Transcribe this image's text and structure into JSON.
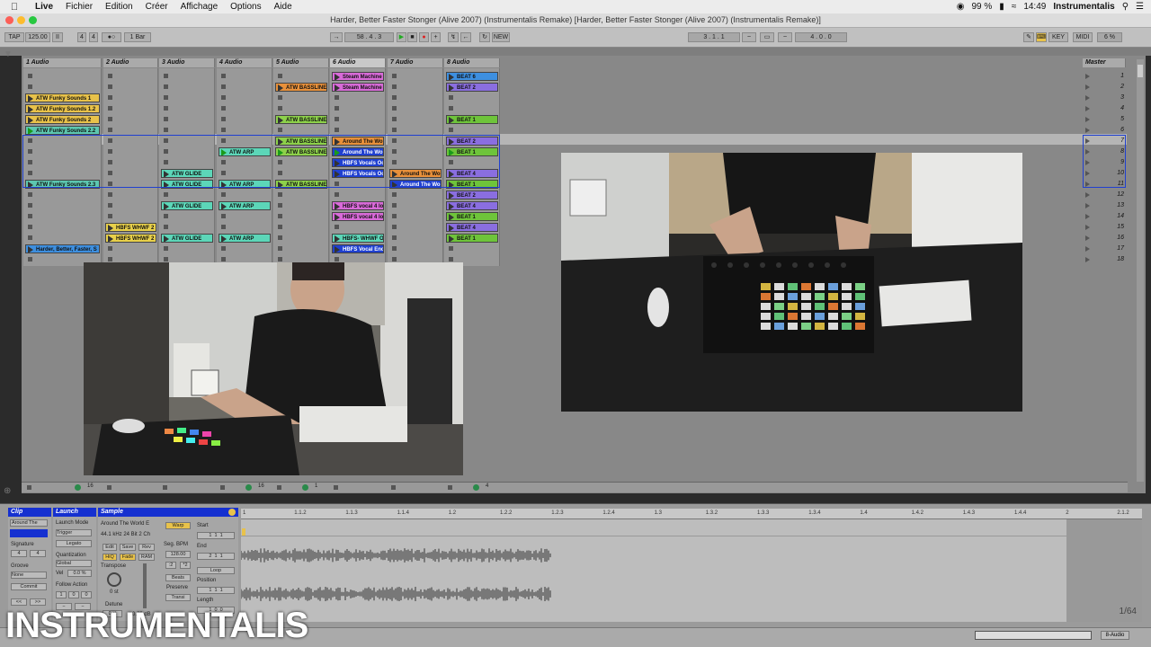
{
  "menubar": {
    "app": "Live",
    "items": [
      "Fichier",
      "Edition",
      "Créer",
      "Affichage",
      "Options",
      "Aide"
    ],
    "battery": "99 %",
    "time": "14:49",
    "user": "Instrumentalis"
  },
  "window_title": "Harder, Better Faster Stonger (Alive 2007) (Instrumentalis Remake)  [Harder, Better Faster Stonger (Alive 2007) (Instrumentalis Remake)]",
  "control_bar": {
    "tap": "TAP",
    "tempo": "125.00",
    "time_sig_num": "4",
    "time_sig_den": "4",
    "quant": "1 Bar",
    "position": "58 .  4 .  3",
    "new_label": "NEW",
    "loop_start": "3 .  1 .  1",
    "loop_len": "4 .  0 .  0",
    "key": "KEY",
    "midi": "MIDI",
    "cpu": "6 %"
  },
  "tracks": [
    {
      "name": "1 Audio"
    },
    {
      "name": "2 Audio"
    },
    {
      "name": "3 Audio"
    },
    {
      "name": "4 Audio"
    },
    {
      "name": "5 Audio"
    },
    {
      "name": "6 Audio"
    },
    {
      "name": "7 Audio"
    },
    {
      "name": "8 Audio"
    }
  ],
  "master": {
    "name": "Master",
    "scenes": [
      "1",
      "2",
      "3",
      "4",
      "5",
      "6",
      "7",
      "8",
      "9",
      "10",
      "11",
      "12",
      "13",
      "14",
      "15",
      "16",
      "17",
      "18"
    ]
  },
  "clips": [
    {
      "t": 0,
      "r": 2,
      "label": "ATW Funky Sounds 1",
      "color": "#e8c24a"
    },
    {
      "t": 0,
      "r": 3,
      "label": "ATW Funky Sounds 1.2",
      "color": "#e8c24a"
    },
    {
      "t": 0,
      "r": 4,
      "label": "ATW Funky Sounds 2",
      "color": "#e8c24a"
    },
    {
      "t": 0,
      "r": 5,
      "label": "ATW Funky Sounds 2.2",
      "color": "#5cc7b0",
      "playing": true
    },
    {
      "t": 0,
      "r": 10,
      "label": "ATW Funky Sounds 2.3",
      "color": "#5cc7b0"
    },
    {
      "t": 0,
      "r": 16,
      "label": "Harder, Better, Faster, S",
      "color": "#3d8fe0"
    },
    {
      "t": 1,
      "r": 14,
      "label": "HBFS WHWF 2",
      "color": "#e8d04a"
    },
    {
      "t": 1,
      "r": 15,
      "label": "HBFS WHWF 2",
      "color": "#e8d04a"
    },
    {
      "t": 2,
      "r": 9,
      "label": "ATW GLIDE",
      "color": "#5cd6b8"
    },
    {
      "t": 2,
      "r": 10,
      "label": "ATW GLIDE",
      "color": "#5cd6b8"
    },
    {
      "t": 2,
      "r": 12,
      "label": "ATW GLIDE",
      "color": "#5cd6b8"
    },
    {
      "t": 2,
      "r": 15,
      "label": "ATW GLIDE",
      "color": "#5cd6b8"
    },
    {
      "t": 3,
      "r": 7,
      "label": "ATW ARP",
      "color": "#5cd6b8",
      "playing": true
    },
    {
      "t": 3,
      "r": 10,
      "label": "ATW ARP",
      "color": "#5cd6b8"
    },
    {
      "t": 3,
      "r": 12,
      "label": "ATW ARP",
      "color": "#5cd6b8"
    },
    {
      "t": 3,
      "r": 15,
      "label": "ATW ARP",
      "color": "#5cd6b8"
    },
    {
      "t": 4,
      "r": 1,
      "label": "ATW BASSLINE",
      "color": "#e8903a"
    },
    {
      "t": 4,
      "r": 4,
      "label": "ATW BASSLINE",
      "color": "#8dd14a"
    },
    {
      "t": 4,
      "r": 6,
      "label": "ATW BASSLINE",
      "color": "#8dd14a"
    },
    {
      "t": 4,
      "r": 7,
      "label": "ATW BASSLINE",
      "color": "#8dd14a",
      "playing": true
    },
    {
      "t": 4,
      "r": 10,
      "label": "ATW BASSLINE",
      "color": "#8dd14a"
    },
    {
      "t": 5,
      "r": 0,
      "label": "Steam Machine",
      "color": "#d86ad8"
    },
    {
      "t": 5,
      "r": 1,
      "label": "Steam Machine",
      "color": "#d86ad8"
    },
    {
      "t": 5,
      "r": 6,
      "label": "Around The Wo",
      "color": "#e8903a"
    },
    {
      "t": 5,
      "r": 7,
      "label": "Around The Wo",
      "color": "#2040d0",
      "playing": true,
      "light": true
    },
    {
      "t": 5,
      "r": 8,
      "label": "HBFS Vocals Oc",
      "color": "#2040d0",
      "light": true
    },
    {
      "t": 5,
      "r": 9,
      "label": "HBFS Vocals Oc",
      "color": "#2040d0",
      "light": true
    },
    {
      "t": 5,
      "r": 12,
      "label": "HBFS vocal 4 lo",
      "color": "#d86ad8"
    },
    {
      "t": 5,
      "r": 13,
      "label": "HBFS vocal 4 lo",
      "color": "#d86ad8"
    },
    {
      "t": 5,
      "r": 15,
      "label": "HBFS- WHWF O",
      "color": "#5cd6b8"
    },
    {
      "t": 5,
      "r": 16,
      "label": "HBFS Vocal End",
      "color": "#2040d0",
      "light": true
    },
    {
      "t": 6,
      "r": 9,
      "label": "Around The Wo",
      "color": "#e8903a"
    },
    {
      "t": 6,
      "r": 10,
      "label": "Around The Wo",
      "color": "#2040d0",
      "light": true
    },
    {
      "t": 7,
      "r": 0,
      "label": "BEAT 6",
      "color": "#3d8fe0"
    },
    {
      "t": 7,
      "r": 1,
      "label": "BEAT 2",
      "color": "#8a6ee0"
    },
    {
      "t": 7,
      "r": 4,
      "label": "BEAT 1",
      "color": "#6ec43a"
    },
    {
      "t": 7,
      "r": 6,
      "label": "BEAT 2",
      "color": "#8a6ee0"
    },
    {
      "t": 7,
      "r": 7,
      "label": "BEAT 1",
      "color": "#6ec43a",
      "playing": true
    },
    {
      "t": 7,
      "r": 9,
      "label": "BEAT 4",
      "color": "#8a6ee0"
    },
    {
      "t": 7,
      "r": 10,
      "label": "BEAT 1",
      "color": "#6ec43a"
    },
    {
      "t": 7,
      "r": 11,
      "label": "BEAT 2",
      "color": "#8a6ee0"
    },
    {
      "t": 7,
      "r": 12,
      "label": "BEAT 4",
      "color": "#8a6ee0"
    },
    {
      "t": 7,
      "r": 13,
      "label": "BEAT 1",
      "color": "#6ec43a"
    },
    {
      "t": 7,
      "r": 14,
      "label": "BEAT 4",
      "color": "#8a6ee0"
    },
    {
      "t": 7,
      "r": 15,
      "label": "BEAT 1",
      "color": "#6ec43a"
    }
  ],
  "track_footer": [
    {
      "t": 0,
      "value": "16"
    },
    {
      "t": 3,
      "value": "16"
    },
    {
      "t": 4,
      "value": "1"
    },
    {
      "t": 7,
      "value": "4"
    }
  ],
  "detail": {
    "clip_panel": {
      "title": "Clip",
      "name": "Around The",
      "signature": "Signature",
      "sig_num": "4",
      "sig_den": "4",
      "groove": "Groove",
      "groove_val": "None",
      "commit": "Commit"
    },
    "launch_panel": {
      "title": "Launch",
      "mode_label": "Launch Mode",
      "mode": "Trigger",
      "legato": "Legato",
      "quant_label": "Quantization",
      "quant": "Global",
      "vel_label": "Vel",
      "vel": "0.0 %",
      "follow": "Follow Action"
    },
    "sample_panel": {
      "title": "Sample",
      "file": "Around The World E",
      "info": "44.1 kHz 24 Bit 2 Ch",
      "warp": "Warp",
      "start": "Start",
      "end": "End",
      "edit": "Edit",
      "save": "Save",
      "rev": "Rev",
      "hiq": "HiQ",
      "fade": "Fade",
      "ram": "RAM",
      "transpose": "Transpose",
      "st": "0 st",
      "detune": "Detune",
      "ct": "0 ct",
      "db": "0.00 dB",
      "seg_bpm": "Seg. BPM",
      "bpm": "128.00",
      "beats": "Beats",
      "preserve": "Preserve",
      "transients": "Transi",
      "loop": "Loop",
      "position": "Position",
      "length": "Length"
    },
    "ruler_marks": [
      "1",
      "1.1.2",
      "1.1.3",
      "1.1.4",
      "1.2",
      "1.2.2",
      "1.2.3",
      "1.2.4",
      "1.3",
      "1.3.2",
      "1.3.3",
      "1.3.4",
      "1.4",
      "1.4.2",
      "1.4.3",
      "1.4.4",
      "2",
      "2.1.2"
    ],
    "zoom": "1/64",
    "track_selector": "8-Audio"
  },
  "brand": "INSTRUMENTALIS"
}
